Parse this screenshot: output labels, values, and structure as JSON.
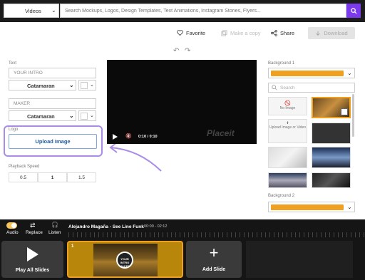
{
  "topbar": {
    "category": "Videos",
    "search_placeholder": "Search Mockups, Logos, Design Templates, Text Animations, Instagram Stories, Flyers..."
  },
  "actions": {
    "favorite": "Favorite",
    "make_copy": "Make a copy",
    "share": "Share",
    "download": "Download"
  },
  "left_panel": {
    "text_label": "Text",
    "text1_value": "YOUR INTRO",
    "text2_value": "MAKER",
    "font1": "Catamaran",
    "font2": "Catamaran",
    "logo_label": "Logo",
    "upload_label": "Upload Image",
    "speed_label": "Playback Speed",
    "speeds": [
      "0.5",
      "1",
      "1.5"
    ]
  },
  "video": {
    "time": "0:10 / 0:10",
    "watermark": "Placeit"
  },
  "right_panel": {
    "bg1_label": "Background 1",
    "bg1_color": "#f0a020",
    "search_placeholder": "Search",
    "no_image": "No Image",
    "upload_image_or_video": "Upload Image or Video",
    "bg2_label": "Background 2",
    "bg2_color": "#f0a020"
  },
  "bottom": {
    "audio": "Audio",
    "replace": "Replace",
    "listen": "Listen",
    "track_title": "Alejandro Magaña - See Line Funk",
    "track_time": "00:00 - 02:12",
    "play_all": "Play All Slides",
    "slide_number": "1",
    "slide_logo_text": "YOUR INTRO MAKER",
    "add_slide": "Add Slide",
    "accent": "#f0a020"
  }
}
